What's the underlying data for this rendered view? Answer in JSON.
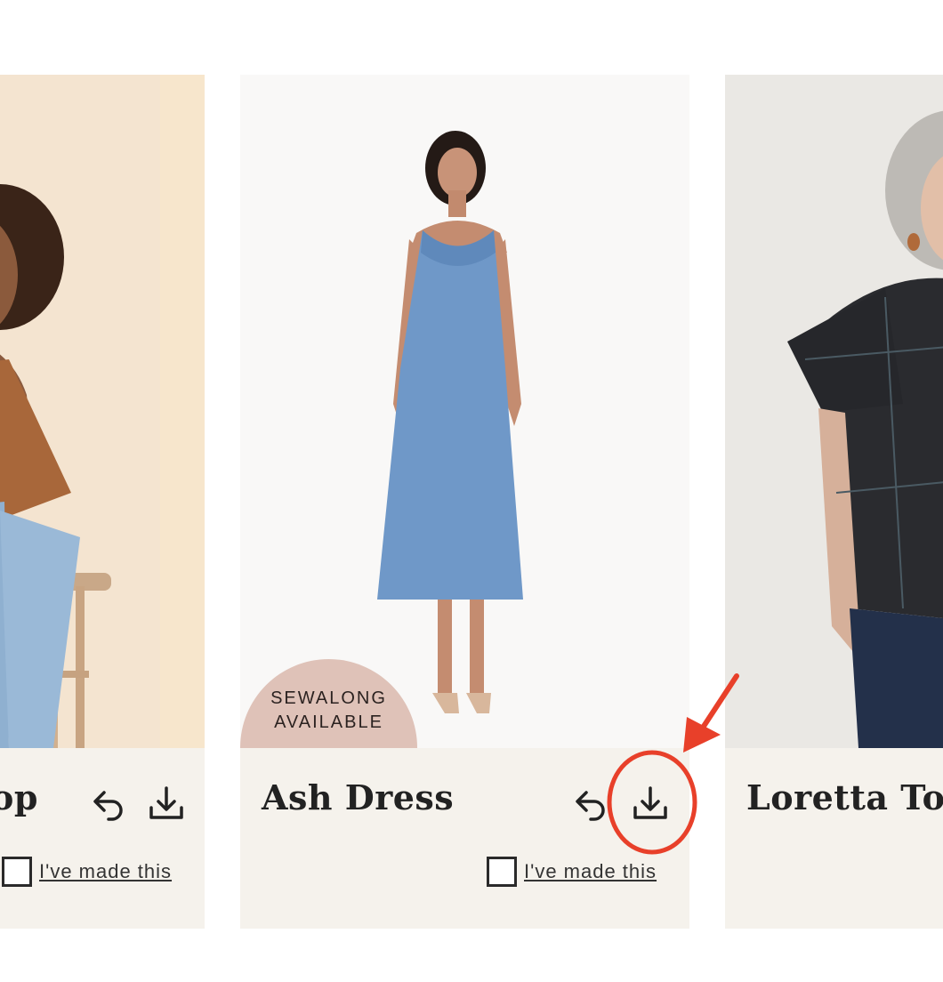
{
  "cards": [
    {
      "title": "op",
      "made_this": "I've made this"
    },
    {
      "title": "Ash Dress",
      "badge_line1": "SEWALONG",
      "badge_line2": "AVAILABLE",
      "made_this": "I've made this"
    },
    {
      "title": "Loretta Top"
    }
  ],
  "icons": {
    "share": "share-icon",
    "download": "download-icon"
  },
  "colors": {
    "card_background": "#f5f2ec",
    "badge": "#dfc2b8",
    "annotation_red": "#e8402a",
    "text_dark": "#222222"
  }
}
